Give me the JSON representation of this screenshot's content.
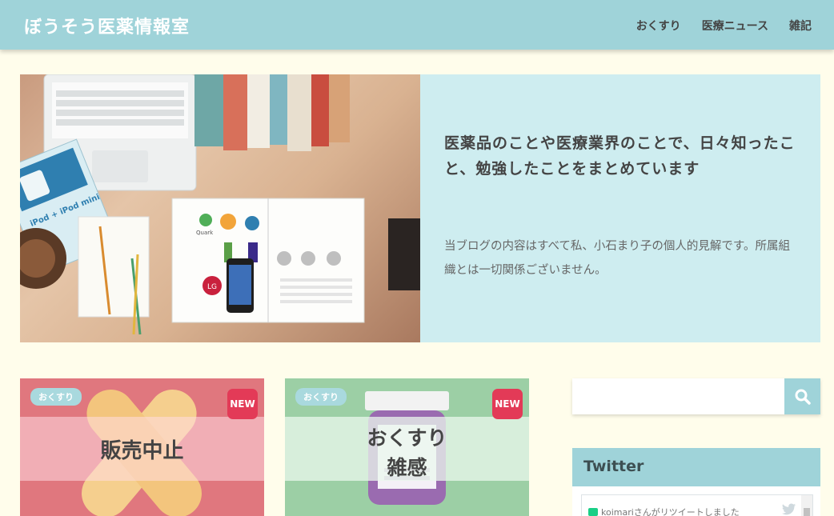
{
  "header": {
    "site_title": "ぼうそう医薬情報室",
    "nav": [
      "おくすり",
      "医療ニュース",
      "雑記"
    ]
  },
  "hero": {
    "heading": "医薬品のことや医療業界のことで、日々知ったこと、勉強したことをまとめています",
    "description": "当ブログの内容はすべて私、小石まり子の個人的見解です。所属組織とは一切関係ございません。",
    "image_text": {
      "ipod_label": "iPod + iPod mini",
      "logo_quark": "Quark",
      "logo_lg": "LG"
    }
  },
  "cards": [
    {
      "category": "おくすり",
      "badge": "NEW",
      "caption_lines": [
        "販売中止"
      ]
    },
    {
      "category": "おくすり",
      "badge": "NEW",
      "caption_lines": [
        "おくすり",
        "雑感"
      ]
    }
  ],
  "search": {
    "placeholder": "",
    "icon": "search-icon"
  },
  "twitter": {
    "title": "Twitter",
    "tweet_preview": "koimariさんがリツイートしました"
  },
  "colors": {
    "header_bg": "#9fd3d9",
    "hero_text_bg": "#ceedf0",
    "page_bg": "#fffdeb",
    "card1_bg": "#e0777e",
    "card2_bg": "#9ccfa5",
    "new_badge": "#e33a57"
  }
}
